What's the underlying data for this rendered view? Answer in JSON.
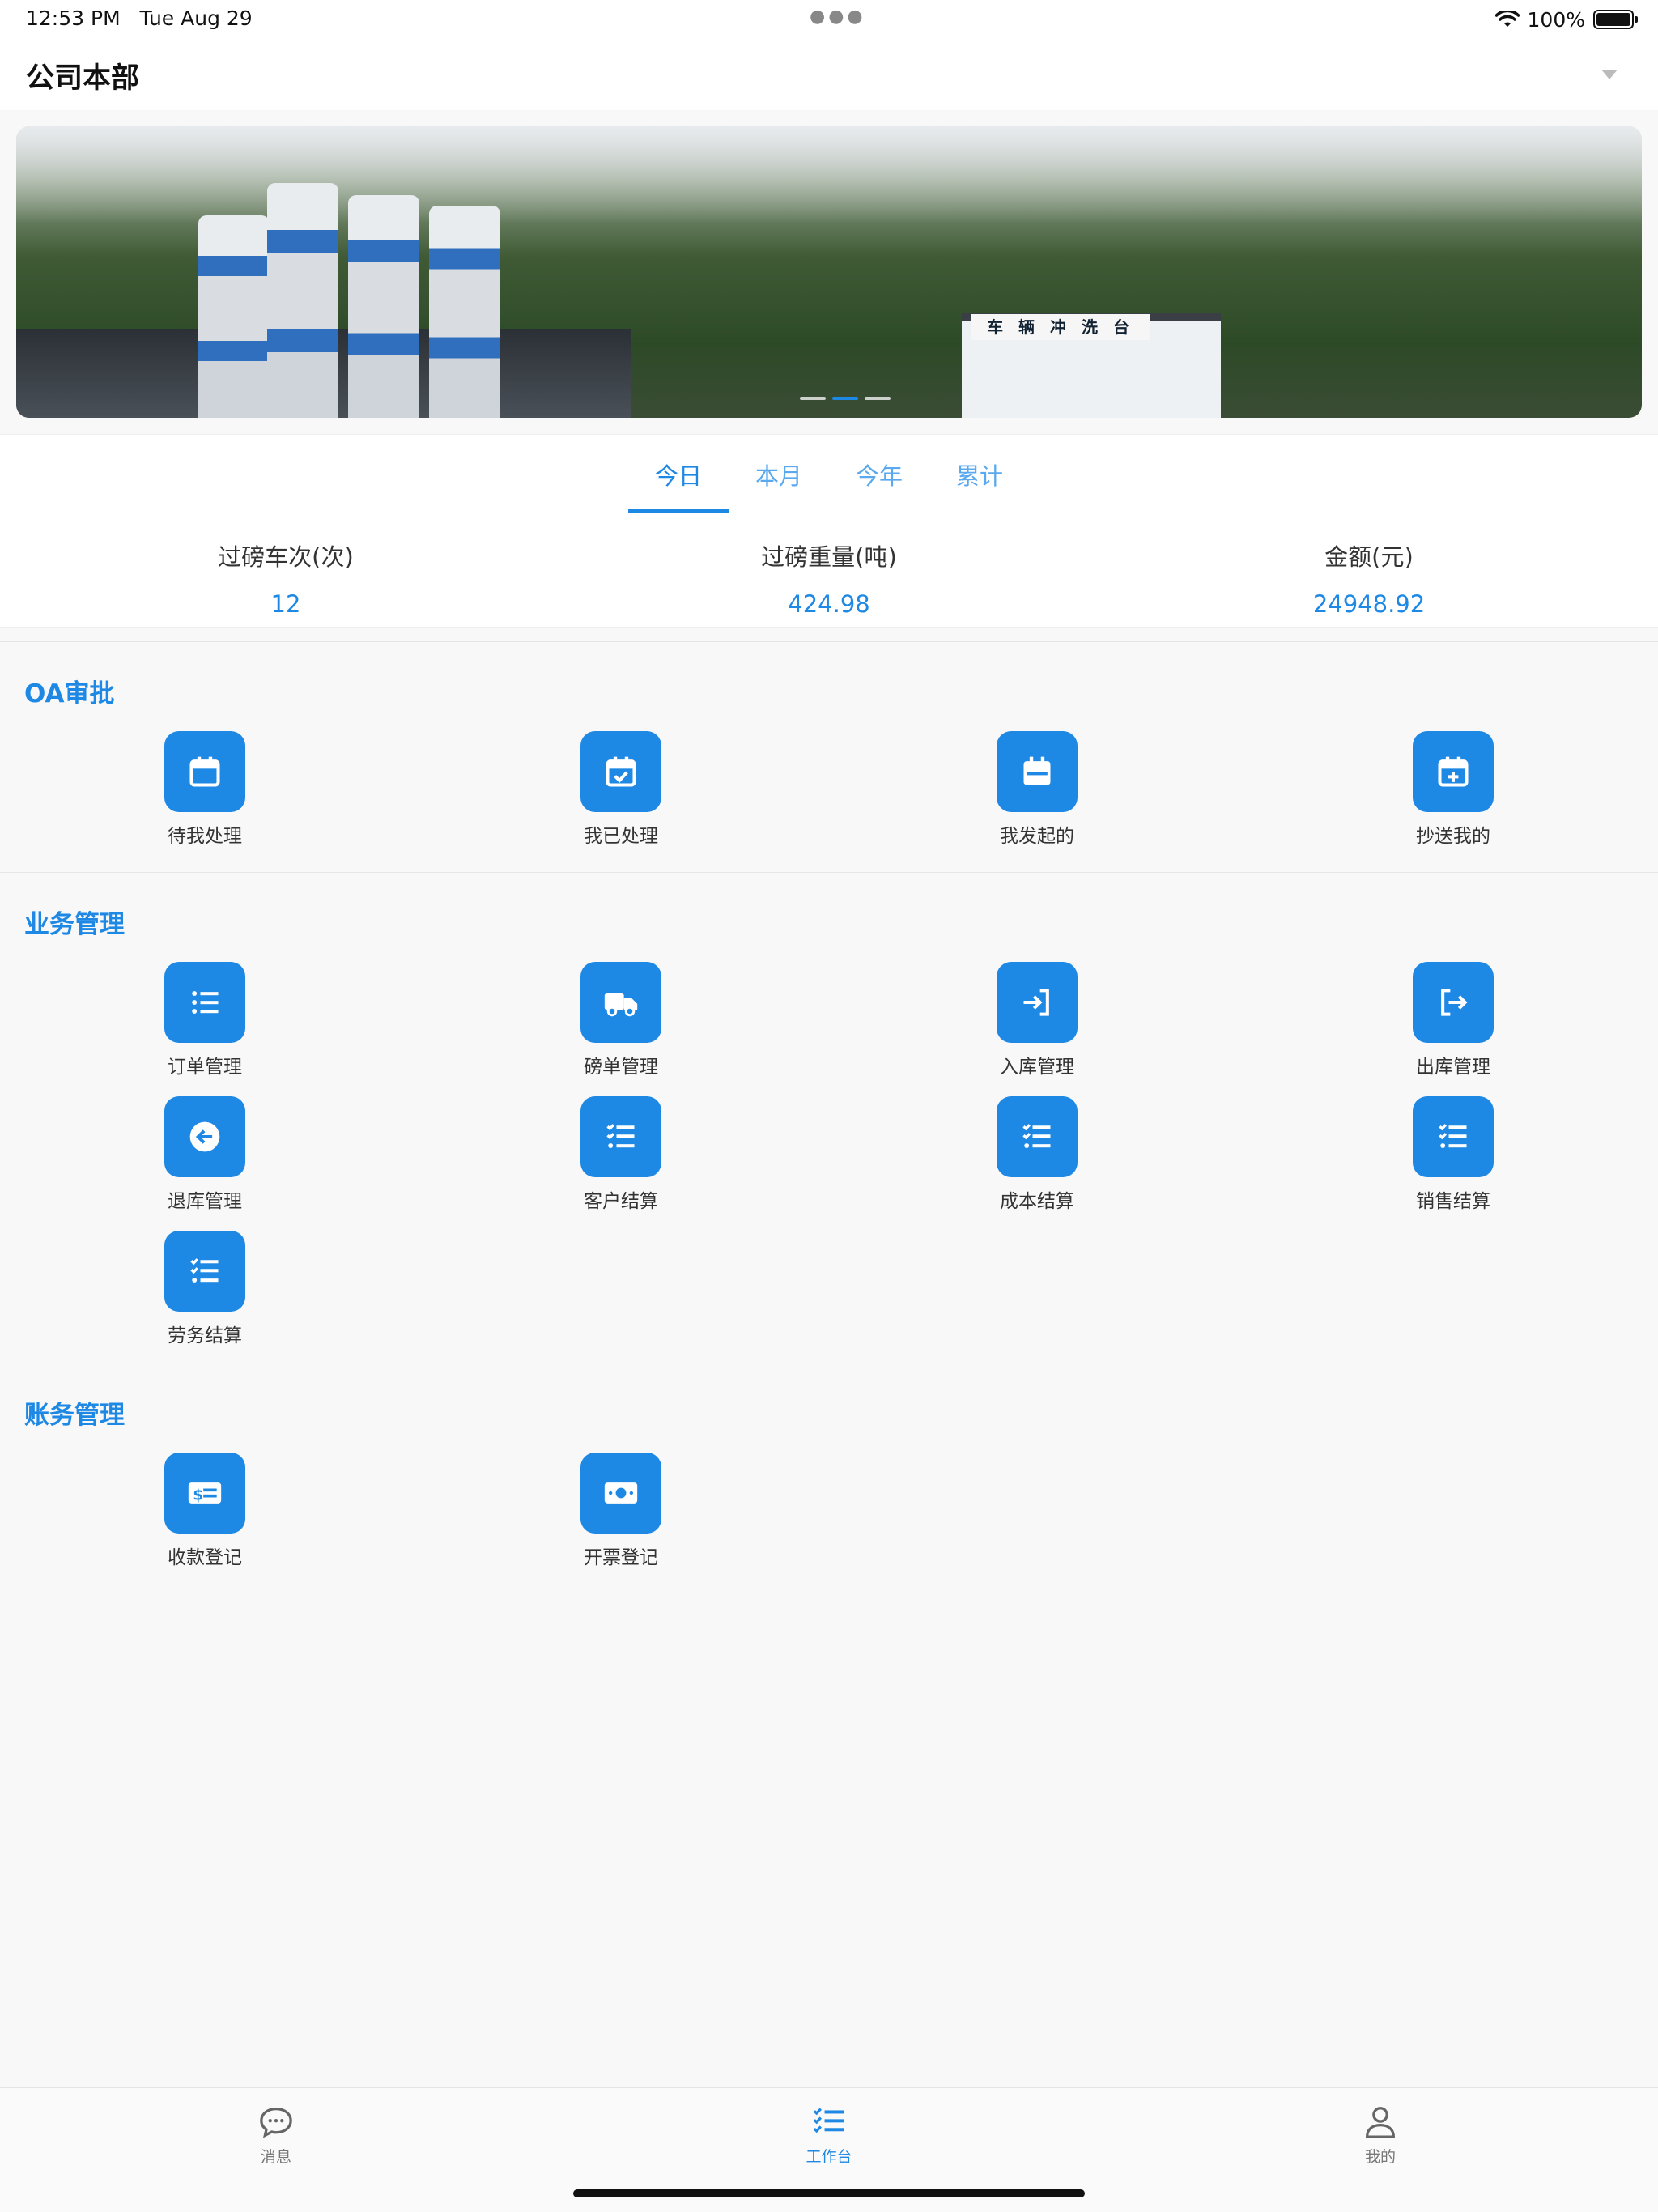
{
  "status_bar": {
    "time": "12:53 PM",
    "date": "Tue Aug 29",
    "battery": "100%"
  },
  "header": {
    "company": "公司本部"
  },
  "banner": {
    "sign_text": "车 辆 冲 洗 台",
    "slides": 3,
    "active_slide": 2
  },
  "stats": {
    "tabs": [
      {
        "label": "今日",
        "active": true
      },
      {
        "label": "本月",
        "active": false
      },
      {
        "label": "今年",
        "active": false
      },
      {
        "label": "累计",
        "active": false
      }
    ],
    "metrics": [
      {
        "label": "过磅车次(次)",
        "value": "12"
      },
      {
        "label": "过磅重量(吨)",
        "value": "424.98"
      },
      {
        "label": "金额(元)",
        "value": "24948.92"
      }
    ]
  },
  "sections": {
    "oa": {
      "title": "OA审批",
      "items": [
        {
          "label": "待我处理",
          "icon": "calendar-icon"
        },
        {
          "label": "我已处理",
          "icon": "calendar-check-icon"
        },
        {
          "label": "我发起的",
          "icon": "calendar-list-icon"
        },
        {
          "label": "抄送我的",
          "icon": "calendar-plus-icon"
        }
      ]
    },
    "business": {
      "title": "业务管理",
      "items": [
        {
          "label": "订单管理",
          "icon": "list-icon"
        },
        {
          "label": "磅单管理",
          "icon": "truck-icon"
        },
        {
          "label": "入库管理",
          "icon": "sign-in-icon"
        },
        {
          "label": "出库管理",
          "icon": "sign-out-icon"
        },
        {
          "label": "退库管理",
          "icon": "arrow-left-circle-icon"
        },
        {
          "label": "客户结算",
          "icon": "checklist-icon"
        },
        {
          "label": "成本结算",
          "icon": "checklist-icon"
        },
        {
          "label": "销售结算",
          "icon": "checklist-icon"
        },
        {
          "label": "劳务结算",
          "icon": "checklist-icon"
        }
      ]
    },
    "finance": {
      "title": "账务管理",
      "items": [
        {
          "label": "收款登记",
          "icon": "money-card-icon"
        },
        {
          "label": "开票登记",
          "icon": "money-bill-icon"
        }
      ]
    }
  },
  "tabbar": [
    {
      "label": "消息",
      "icon": "chat-icon",
      "active": false
    },
    {
      "label": "工作台",
      "icon": "checklist-icon",
      "active": true
    },
    {
      "label": "我的",
      "icon": "user-icon",
      "active": false
    }
  ]
}
